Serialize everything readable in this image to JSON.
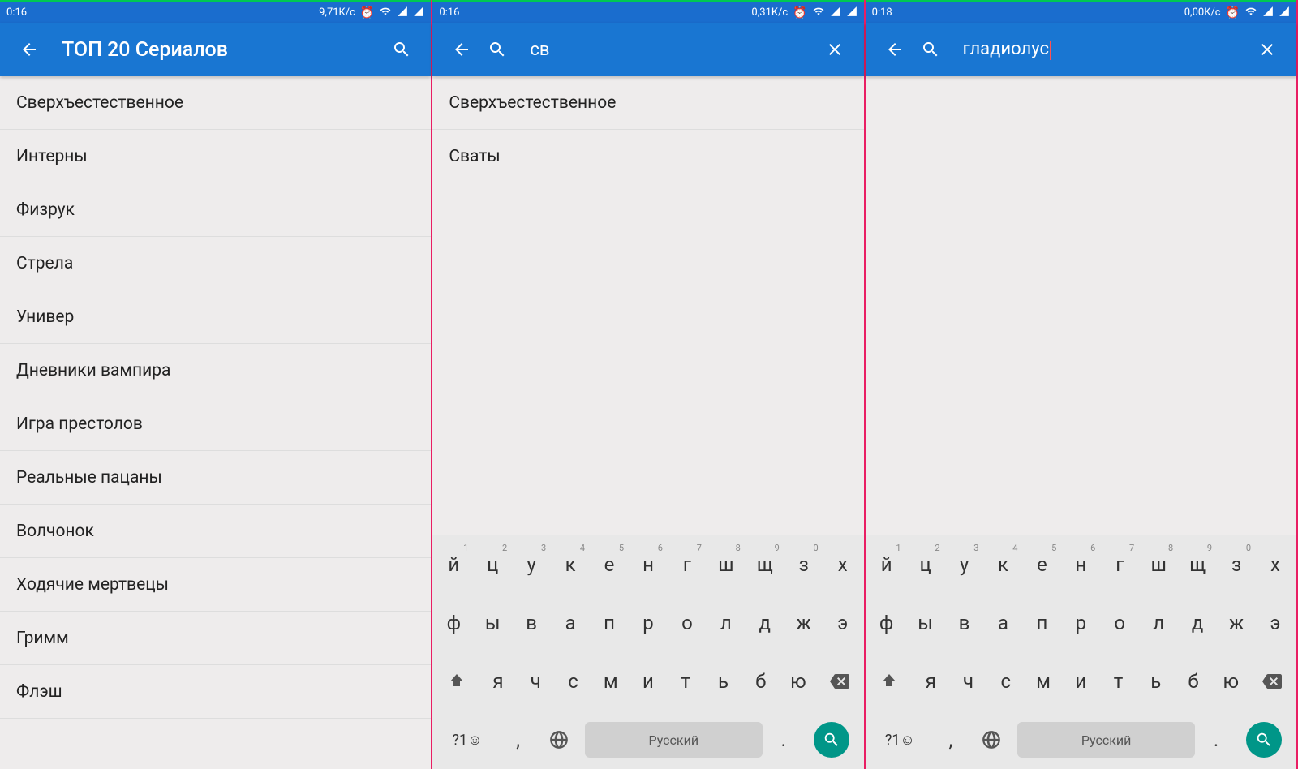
{
  "phone1": {
    "status": {
      "time": "0:16",
      "speed": "9,71K/с"
    },
    "toolbar": {
      "title": "ТОП 20 Сериалов"
    },
    "list": [
      "Сверхъестественное",
      "Интерны",
      "Физрук",
      "Стрела",
      "Универ",
      "Дневники вампира",
      "Игра престолов",
      "Реальные пацаны",
      "Волчонок",
      "Ходячие мертвецы",
      "Гримм",
      "Флэш"
    ]
  },
  "phone2": {
    "status": {
      "time": "0:16",
      "speed": "0,31K/с"
    },
    "search": {
      "query": "св"
    },
    "results": [
      "Сверхъестественное",
      "Сваты"
    ]
  },
  "phone3": {
    "status": {
      "time": "0:18",
      "speed": "0,00K/с"
    },
    "search": {
      "query": "гладиолус"
    },
    "results": []
  },
  "keyboard": {
    "row1": [
      "й",
      "ц",
      "у",
      "к",
      "е",
      "н",
      "г",
      "ш",
      "щ",
      "з",
      "х"
    ],
    "row1_nums": [
      "1",
      "2",
      "3",
      "4",
      "5",
      "6",
      "7",
      "8",
      "9",
      "0",
      ""
    ],
    "row2": [
      "ф",
      "ы",
      "в",
      "а",
      "п",
      "р",
      "о",
      "л",
      "д",
      "ж",
      "э"
    ],
    "row3": [
      "я",
      "ч",
      "с",
      "м",
      "и",
      "т",
      "ь",
      "б",
      "ю"
    ],
    "row4": {
      "symbols": "?1☺",
      "comma": ",",
      "space": "Русский",
      "period": "."
    }
  }
}
